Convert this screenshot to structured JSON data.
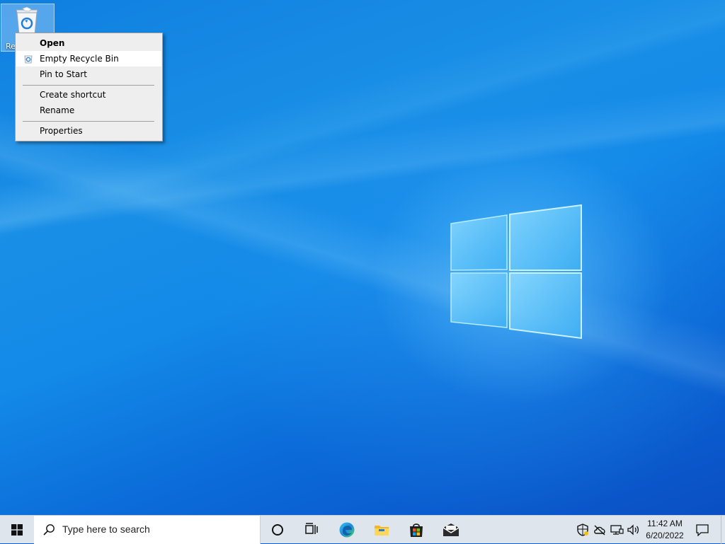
{
  "desktop": {
    "recycle_bin": {
      "icon": "recycle-bin-icon",
      "label": "Re"
    }
  },
  "context_menu": {
    "items": [
      {
        "label": "Open",
        "bold": true
      },
      {
        "label": "Empty Recycle Bin",
        "icon": "recycle-icon",
        "highlighted": true
      },
      {
        "label": "Pin to Start"
      },
      {
        "label": "Create shortcut"
      },
      {
        "label": "Rename"
      },
      {
        "label": "Properties"
      }
    ]
  },
  "taskbar": {
    "start": {
      "icon": "windows-start-icon"
    },
    "search": {
      "placeholder": "Type here to search",
      "icon": "search-icon"
    },
    "buttons": [
      {
        "name": "cortana",
        "icon": "cortana-circle-icon"
      },
      {
        "name": "task-view",
        "icon": "task-view-icon"
      },
      {
        "name": "edge",
        "icon": "edge-browser-icon"
      },
      {
        "name": "file-explorer",
        "icon": "folder-icon"
      },
      {
        "name": "microsoft-store",
        "icon": "store-bag-icon"
      },
      {
        "name": "mail",
        "icon": "mail-envelope-icon"
      }
    ],
    "tray": {
      "icons": [
        "shield-icon",
        "onedrive-cloud-icon",
        "network-icon",
        "volume-icon"
      ],
      "time": "11:42 AM",
      "date": "6/20/2022",
      "notification_icon": "notification-icon"
    }
  },
  "colors": {
    "wallpaper_primary": "#0a5fd6",
    "taskbar": "#dfe5ec",
    "menu_background": "#eeeeee",
    "menu_highlight": "#ffffff"
  }
}
